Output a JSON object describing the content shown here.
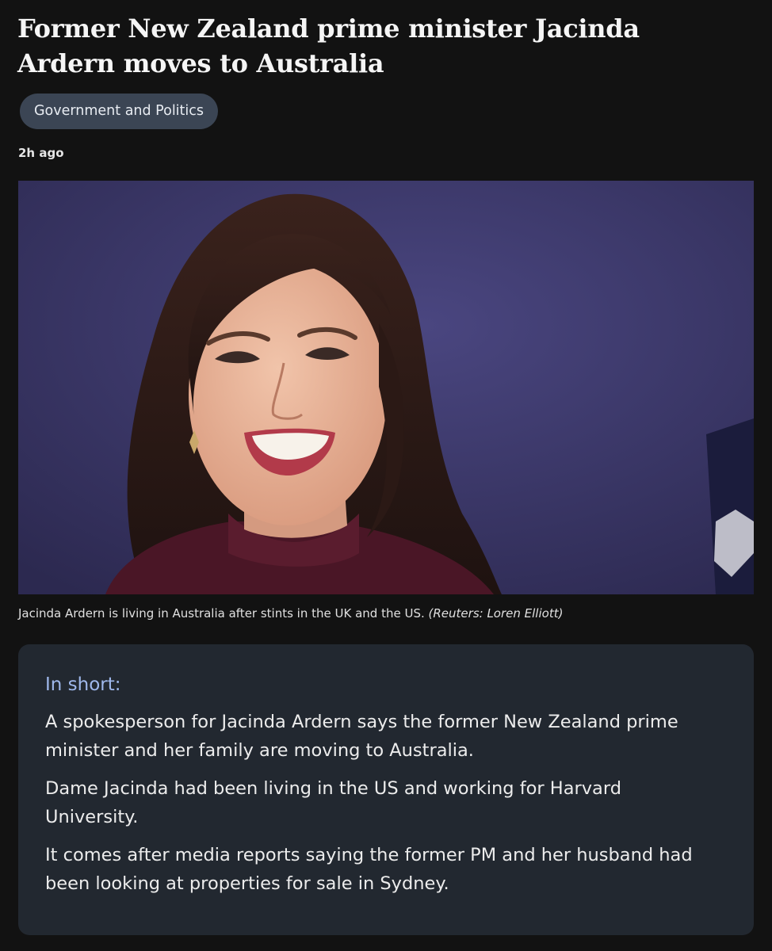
{
  "article": {
    "headline": "Former New Zealand prime minister Jacinda Ardern moves to Australia",
    "topic_tag": "Government and Politics",
    "timestamp": "2h ago"
  },
  "photo": {
    "caption": "Jacinda Ardern is living in Australia after stints in the UK and the US.",
    "credit": "(Reuters: Loren Elliott)"
  },
  "summary": {
    "heading": "In short:",
    "paragraphs": [
      "A spokesperson for Jacinda Ardern says the former New Zealand prime minister and her family are moving to Australia.",
      "Dame Jacinda had been living in the US and working for Harvard University.",
      "It comes after media reports saying the former PM and her husband had been looking at properties for sale in Sydney."
    ]
  },
  "colors": {
    "page_background": "#121212",
    "tag_background": "#3b4554",
    "summary_background": "#222830",
    "summary_heading": "#9fb8ec"
  }
}
